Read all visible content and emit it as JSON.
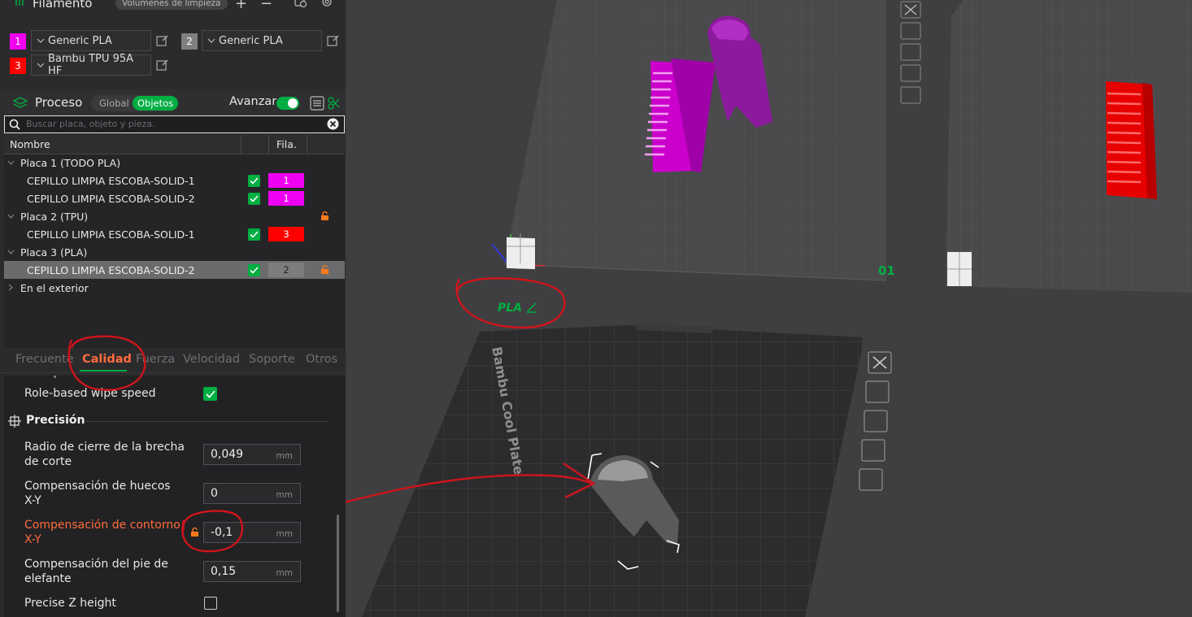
{
  "filament": {
    "title": "Filamento",
    "cleaning_badge": "Volúmenes de limpieza",
    "items": [
      {
        "num": "1",
        "name": "Generic PLA",
        "color": "#f000f0"
      },
      {
        "num": "2",
        "name": "Generic PLA",
        "color": "#808080"
      },
      {
        "num": "3",
        "name": "Bambu TPU 95A HF",
        "color": "#ff0000"
      }
    ]
  },
  "process": {
    "title": "Proceso",
    "toggle_global": "Global",
    "toggle_objects": "Objetos",
    "advance_label": "Avanzar",
    "search_placeholder": "Buscar placa, objeto y pieza."
  },
  "tree": {
    "col_name": "Nombre",
    "col_fila": "Fila.",
    "rows": [
      {
        "label": "Placa 1 (TODO PLA)"
      },
      {
        "label": "CEPILLO LIMPIA ESCOBA-SOLID-1",
        "fila": "1"
      },
      {
        "label": "CEPILLO LIMPIA ESCOBA-SOLID-2",
        "fila": "1"
      },
      {
        "label": "Placa 2 (TPU)"
      },
      {
        "label": "CEPILLO LIMPIA ESCOBA-SOLID-1",
        "fila": "3"
      },
      {
        "label": "Placa 3 (PLA)"
      },
      {
        "label": "CEPILLO LIMPIA ESCOBA-SOLID-2",
        "fila": "2"
      },
      {
        "label": "En el exterior"
      }
    ]
  },
  "tabs": [
    "Frecuente",
    "Calidad",
    "Fuerza",
    "Velocidad",
    "Soporte",
    "Otros"
  ],
  "settings": {
    "role_wipe": "Role-based wipe speed",
    "section": "Precisión",
    "params": [
      {
        "label_1": "Radio de cierre de la brecha",
        "label_2": "de corte",
        "value": "0,049",
        "unit": "mm"
      },
      {
        "label_1": "Compensación de huecos",
        "label_2": "X-Y",
        "value": "0",
        "unit": "mm"
      },
      {
        "label_1": "Compensación de contorno",
        "label_2": "X-Y",
        "value": "-0,1",
        "unit": "mm"
      },
      {
        "label_1": "Compensación del pie de",
        "label_2": "elefante",
        "value": "0,15",
        "unit": "mm"
      }
    ],
    "precise_z": "Precise Z height"
  },
  "viewport": {
    "plate_number": "01",
    "plate_label": "PLA",
    "bed_brand": "Bambu Cool Plate"
  },
  "colors": {
    "accent_green": "#00ae42",
    "highlight_orange": "#ff6b3d",
    "annotation_red": "#d0141b"
  }
}
